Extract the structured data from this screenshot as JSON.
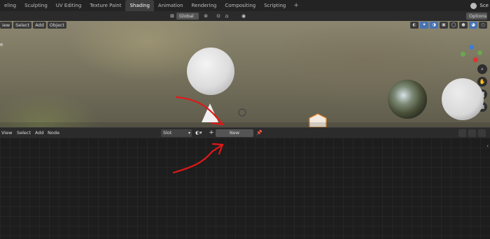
{
  "workspace_tabs": [
    "eling",
    "Sculpting",
    "UV Editing",
    "Texture Paint",
    "Shading",
    "Animation",
    "Rendering",
    "Compositing",
    "Scripting"
  ],
  "active_tab": "Shading",
  "add_tab_label": "+",
  "scene_label": "Sce",
  "header": {
    "orientation_value": "Global",
    "options_label": "Options"
  },
  "viewport": {
    "menu": [
      "iew",
      "Select",
      "Add",
      "Object"
    ],
    "left_edge_label": "e"
  },
  "node_editor": {
    "menu": [
      "View",
      "Select",
      "Add",
      "Node"
    ],
    "slot_label": "Slot",
    "new_button_label": "New",
    "plus_label": "+"
  },
  "colors": {
    "annotation_red": "#e01818",
    "active_tab_bg": "#3d3d3d",
    "highlight_blue": "#4772b3"
  }
}
